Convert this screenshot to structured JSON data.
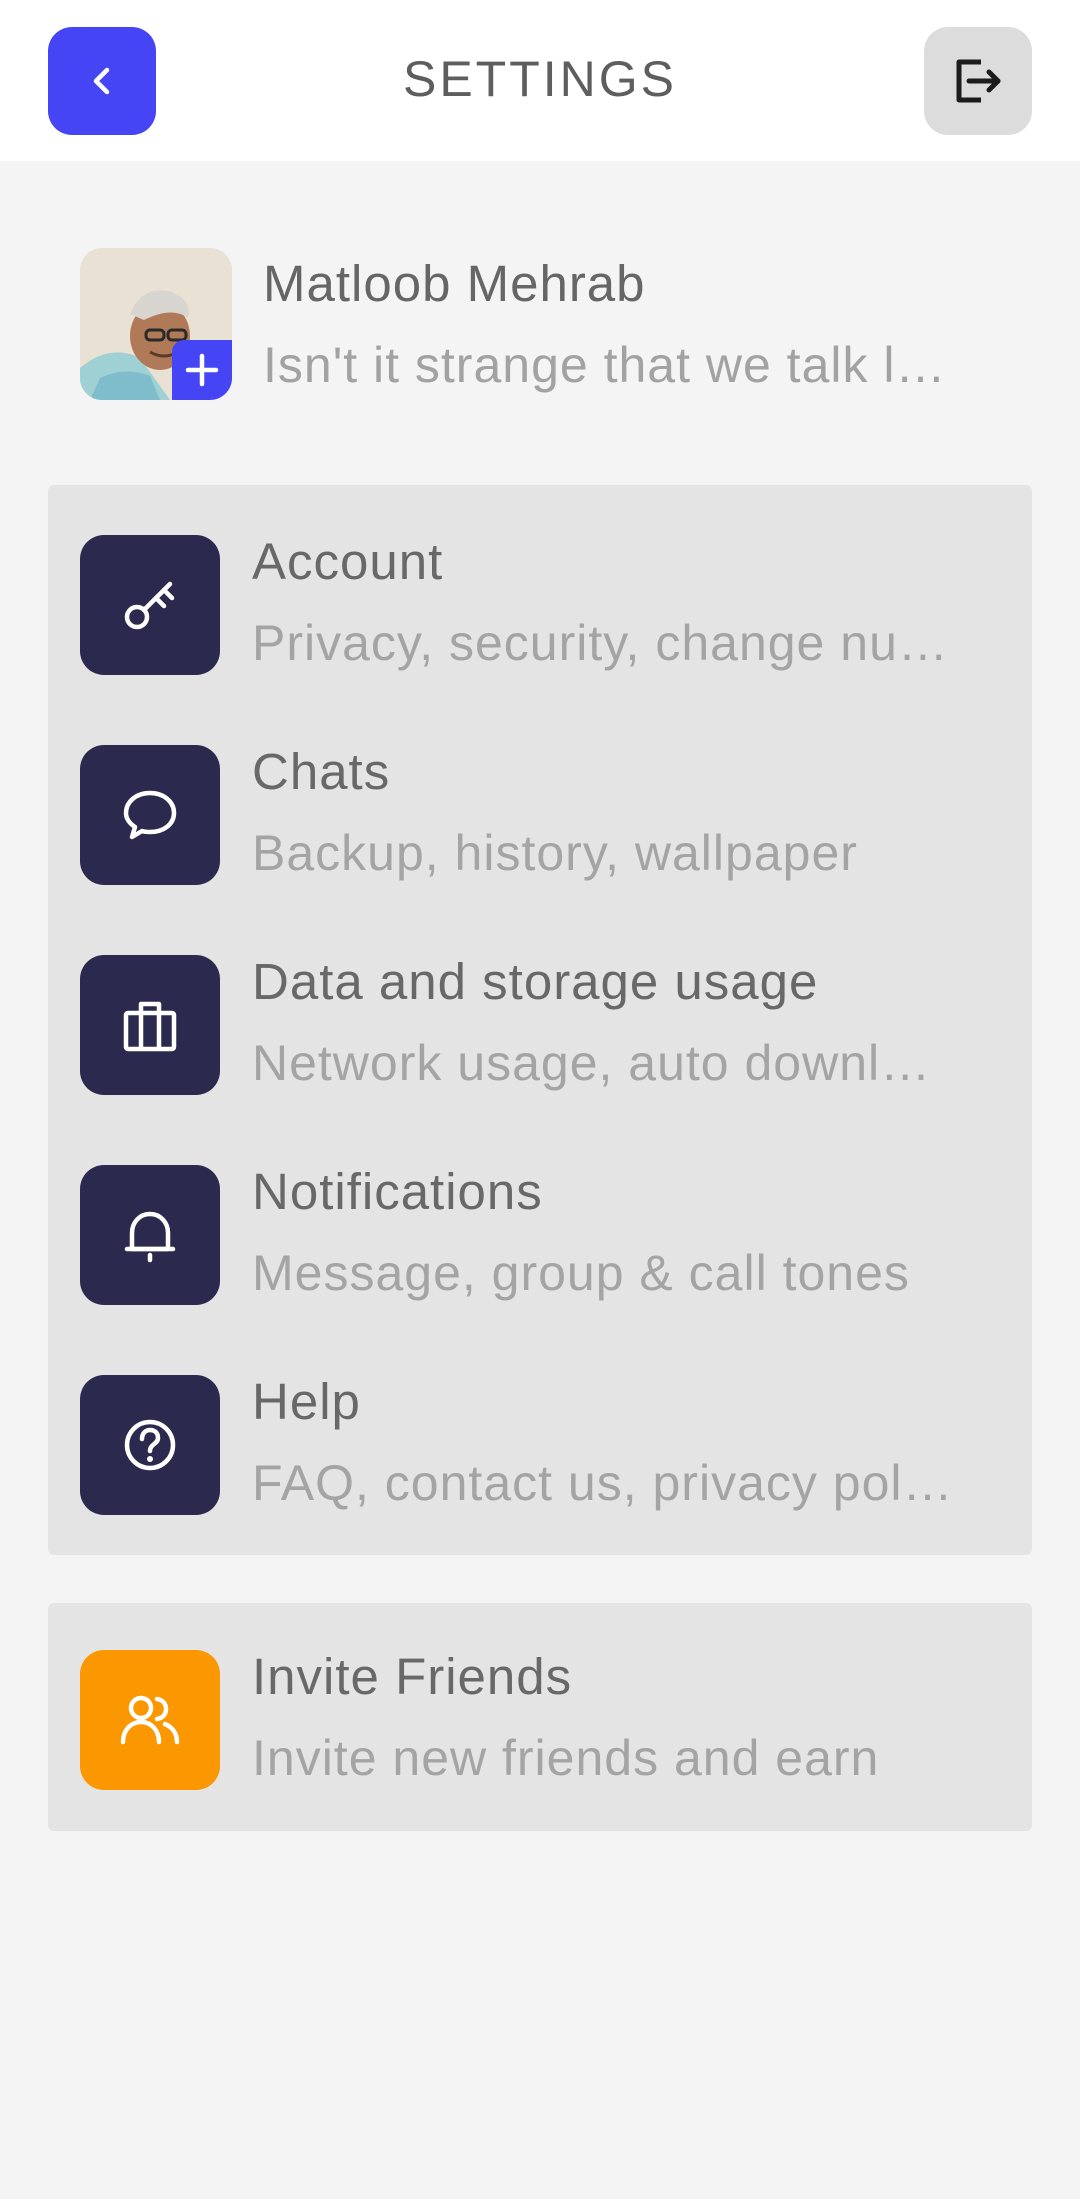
{
  "header": {
    "title": "SETTINGS",
    "back_icon": "chevron-left-icon",
    "logout_icon": "logout-icon",
    "accent_color": "#4545f5"
  },
  "profile": {
    "name": "Matloob Mehrab",
    "status": "Isn't it strange that we talk l…",
    "add_icon": "plus-icon"
  },
  "settings": {
    "items": [
      {
        "title": "Account",
        "subtitle": "Privacy, security, change nu…",
        "icon": "key-icon"
      },
      {
        "title": "Chats",
        "subtitle": "Backup, history, wallpaper",
        "icon": "chat-bubble-icon"
      },
      {
        "title": "Data and storage usage",
        "subtitle": "Network usage, auto downl…",
        "icon": "briefcase-icon"
      },
      {
        "title": "Notifications",
        "subtitle": "Message, group & call tones",
        "icon": "bell-icon"
      },
      {
        "title": "Help",
        "subtitle": "FAQ, contact us, privacy pol…",
        "icon": "help-circle-icon"
      }
    ],
    "icon_bg_color": "#2b2a4e"
  },
  "invite": {
    "title": "Invite Friends",
    "subtitle": "Invite new friends and earn",
    "icon": "users-icon",
    "icon_bg_color": "#fb9700"
  }
}
